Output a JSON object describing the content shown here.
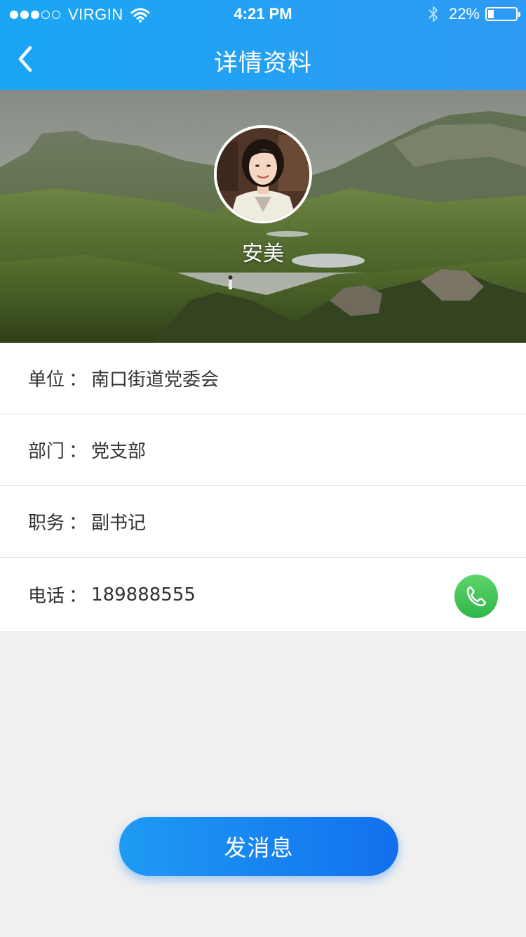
{
  "status_bar": {
    "carrier": "VIRGIN",
    "time": "4:21 PM",
    "battery_text": "22%",
    "battery_level": 0.22,
    "signal_bars_filled": 3,
    "signal_bars_total": 5
  },
  "nav": {
    "title": "详情资料",
    "back_icon": "chevron-left-icon"
  },
  "profile": {
    "name": "安美"
  },
  "info": {
    "rows": [
      {
        "label": "单位",
        "separator": "：",
        "value": "南口街道党委会"
      },
      {
        "label": "部门",
        "separator": "：",
        "value": "党支部"
      },
      {
        "label": "职务",
        "separator": "：",
        "value": "副书记"
      },
      {
        "label": "电话",
        "separator": "：",
        "value": "189888555"
      }
    ]
  },
  "actions": {
    "send_message": "发消息",
    "call_icon": "phone-icon"
  },
  "colors": {
    "header": "#1aa6f5",
    "call": "#34b84c",
    "button": "#1e8cf2",
    "background": "#f0f0f0"
  }
}
